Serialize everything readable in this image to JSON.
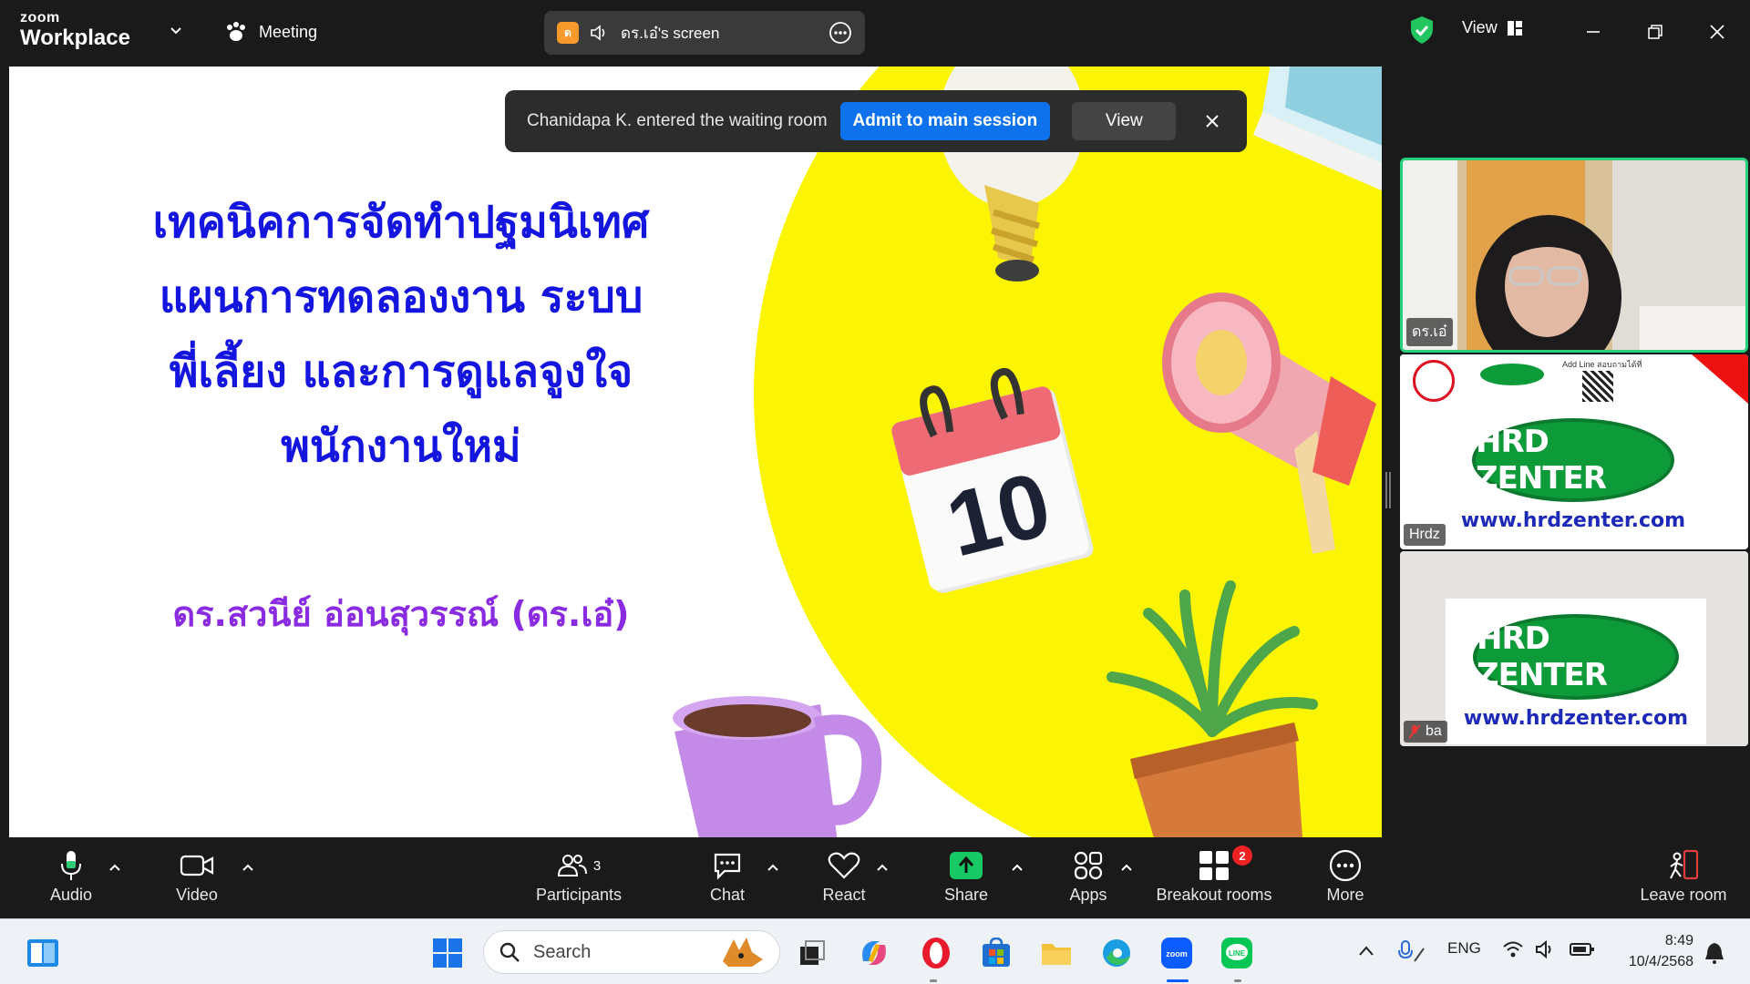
{
  "topbar": {
    "brand_small": "zoom",
    "brand_large": "Workplace",
    "meeting_label": "Meeting",
    "share_avatar": "ด",
    "share_label": "ดร.เอ๋'s screen",
    "view_label": "View",
    "accent": "#0e72ed",
    "secure_color": "#22c55e"
  },
  "slide": {
    "title_lines": [
      "เทคนิคการจัดทำปฐมนิเทศ",
      "แผนการทดลองงาน ระบบ",
      "พี่เลี้ยง และการดูแลจูงใจ",
      "พนักงานใหม่"
    ],
    "presenter": "ดร.สวนีย์  อ่อนสุวรรณ์ (ดร.เอ๋)",
    "calendar_day": "10",
    "title_color": "#1515e0",
    "presenter_color": "#8a2be2",
    "circle_color": "#fbf402"
  },
  "notification": {
    "text": "Chanidapa K. entered the waiting room",
    "admit_label": "Admit to main session",
    "view_label": "View"
  },
  "gallery": {
    "tile1_name": "ดร.เอ๋",
    "tile2_name": "Hrdz",
    "tile3_name": "ba",
    "hrd_logo": "HRD ZENTER",
    "hrd_url": "www.hrdzenter.com",
    "line_ad": "Add Line สอบถามได้ที่"
  },
  "toolbar": {
    "audio": "Audio",
    "video": "Video",
    "participants": "Participants",
    "participants_count": "3",
    "chat": "Chat",
    "react": "React",
    "share": "Share",
    "apps": "Apps",
    "breakout": "Breakout rooms",
    "breakout_badge": "2",
    "more": "More",
    "leave": "Leave room"
  },
  "taskbar": {
    "search_placeholder": "Search",
    "lang": "ENG",
    "time": "8:49",
    "date": "10/4/2568"
  }
}
